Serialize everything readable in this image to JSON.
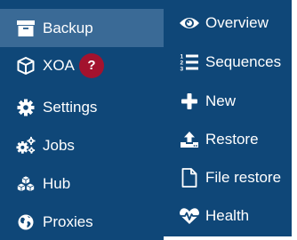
{
  "sidebar": {
    "items": [
      {
        "label": "Backup",
        "icon": "archive-icon",
        "active": true
      },
      {
        "label": "XOA",
        "icon": "cube-icon",
        "badge": "?"
      },
      {
        "label": "Settings",
        "icon": "gear-icon"
      },
      {
        "label": "Jobs",
        "icon": "gears-icon"
      },
      {
        "label": "Hub",
        "icon": "cubes-icon"
      },
      {
        "label": "Proxies",
        "icon": "globe-icon"
      }
    ]
  },
  "submenu": {
    "items": [
      {
        "label": "Overview",
        "icon": "eye-icon"
      },
      {
        "label": "Sequences",
        "icon": "numbered-list-icon"
      },
      {
        "label": "New",
        "icon": "plus-icon"
      },
      {
        "label": "Restore",
        "icon": "upload-icon"
      },
      {
        "label": "File restore",
        "icon": "file-icon"
      },
      {
        "label": "Health",
        "icon": "heartbeat-icon"
      }
    ]
  },
  "colors": {
    "sidebar_bg": "#0f4778",
    "active_bg": "#3a6a96",
    "badge_bg": "#a3122e",
    "text": "#ffffff"
  }
}
